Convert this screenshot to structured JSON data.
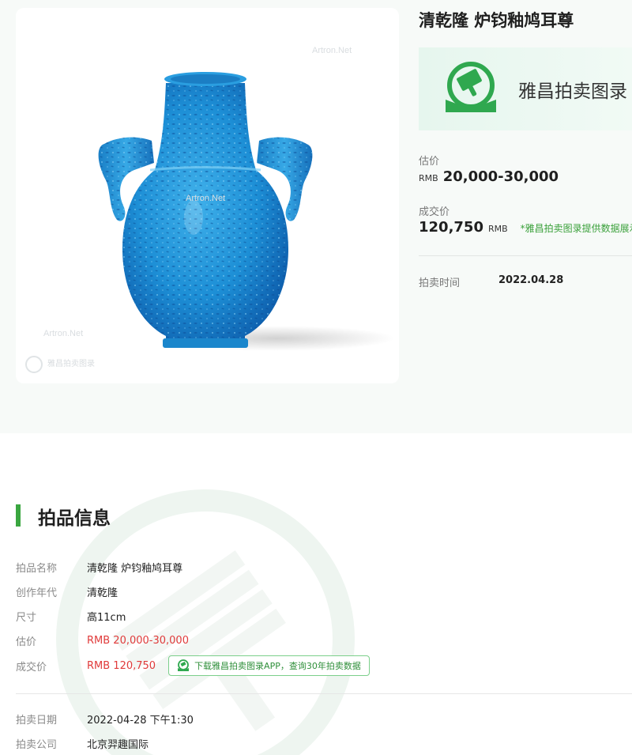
{
  "lot": {
    "title": "清乾隆 炉钧釉鸠耳尊",
    "watermark_text": "Artron.Net",
    "watermark_logo_text": "雅昌拍卖图录",
    "banner_text": "雅昌拍卖图录",
    "estimate_label": "估价",
    "estimate_unit": "RMB",
    "estimate_value": "20,000-30,000",
    "sold_label": "成交价",
    "sold_value": "120,750",
    "sold_unit": "RMB",
    "sold_note": "*雅昌拍卖图录提供数据展示",
    "auction_time_label": "拍卖时间",
    "auction_time_value": "2022.04.28"
  },
  "info": {
    "section_title": "拍品信息",
    "rows": [
      {
        "label": "拍品名称",
        "value": "清乾隆 炉钧釉鸠耳尊"
      },
      {
        "label": "创作年代",
        "value": "清乾隆"
      },
      {
        "label": "尺寸",
        "value": "高11cm"
      },
      {
        "label": "估价",
        "value": "RMB 20,000-30,000"
      },
      {
        "label": "成交价",
        "value": "RMB 120,750"
      }
    ],
    "app_promo": "下载雅昌拍卖图录APP，查询30年拍卖数据",
    "rows2": [
      {
        "label": "拍卖日期",
        "value": "2022-04-28 下午1:30"
      },
      {
        "label": "拍卖公司",
        "value": "北京羿趣国际"
      }
    ]
  },
  "colors": {
    "accent_green": "#3aa640",
    "price_red": "#e03a3a",
    "vase_blue": "#1f8fd6"
  }
}
